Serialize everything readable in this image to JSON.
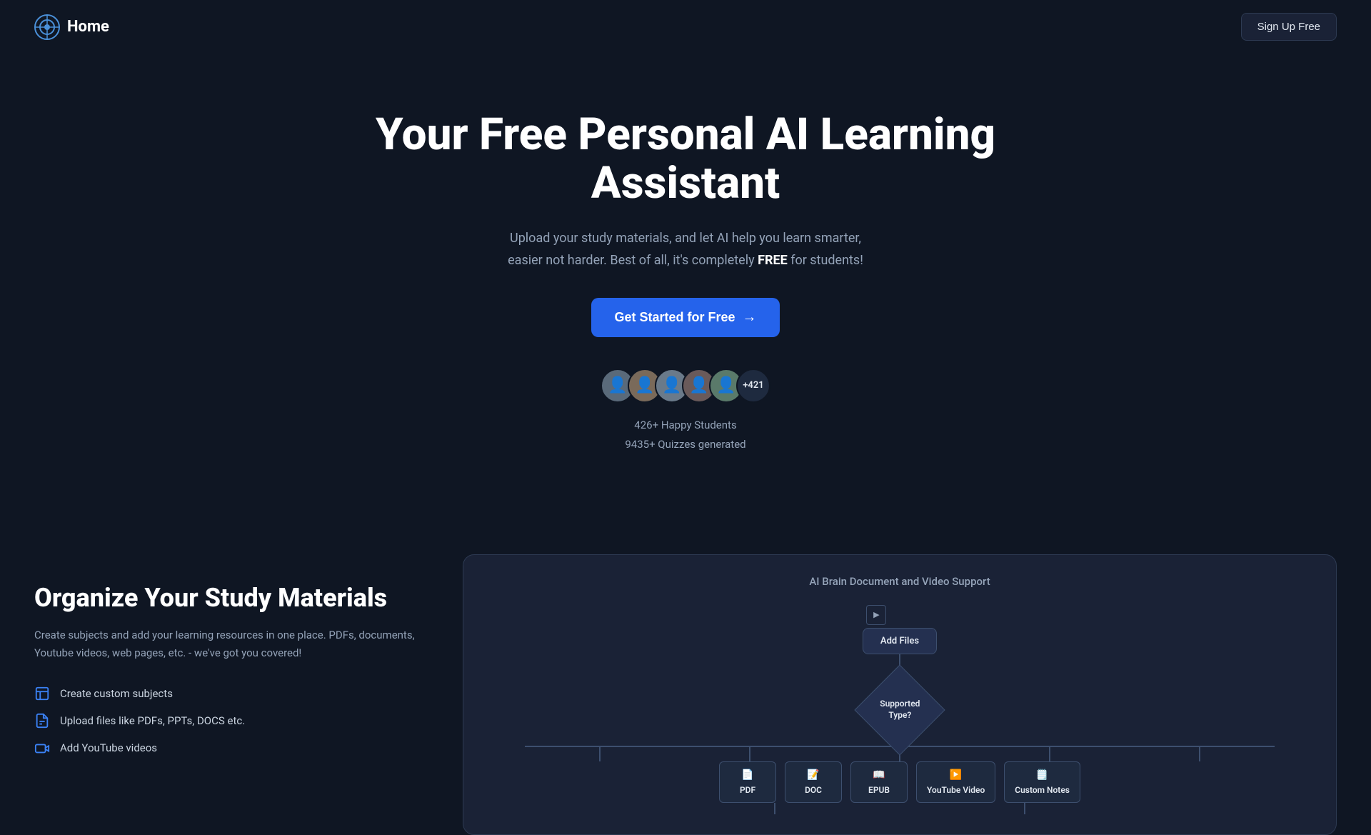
{
  "navbar": {
    "logo_text": "Home",
    "signup_label": "Sign Up Free"
  },
  "hero": {
    "title": "Your Free Personal AI Learning Assistant",
    "subtitle_part1": "Upload your study materials, and let AI help you learn smarter, easier not harder. Best of all, it's completely ",
    "subtitle_free": "FREE",
    "subtitle_part2": " for students!",
    "cta_label": "Get Started for Free",
    "cta_arrow": "→",
    "avatar_count": "+421",
    "stats_line1": "426+ Happy Students",
    "stats_line2": "9435+ Quizzes generated"
  },
  "features_section": {
    "title": "Organize Your Study Materials",
    "description": "Create subjects and add your learning resources in one place. PDFs, documents, Youtube videos, web pages, etc. - we've got you covered!",
    "items": [
      {
        "icon": "📚",
        "label": "Create custom subjects"
      },
      {
        "icon": "📄",
        "label": "Upload files like PDFs, PPTs, DOCS etc."
      },
      {
        "icon": "🎬",
        "label": "Add YouTube videos"
      }
    ]
  },
  "diagram": {
    "title": "AI Brain Document and Video Support",
    "nodes": {
      "add_files": "Add Files",
      "supported_type": "Supported\nType?",
      "leaves": [
        "PDF",
        "DOC",
        "EPUB",
        "YouTube Video",
        "Custom Notes"
      ]
    }
  }
}
